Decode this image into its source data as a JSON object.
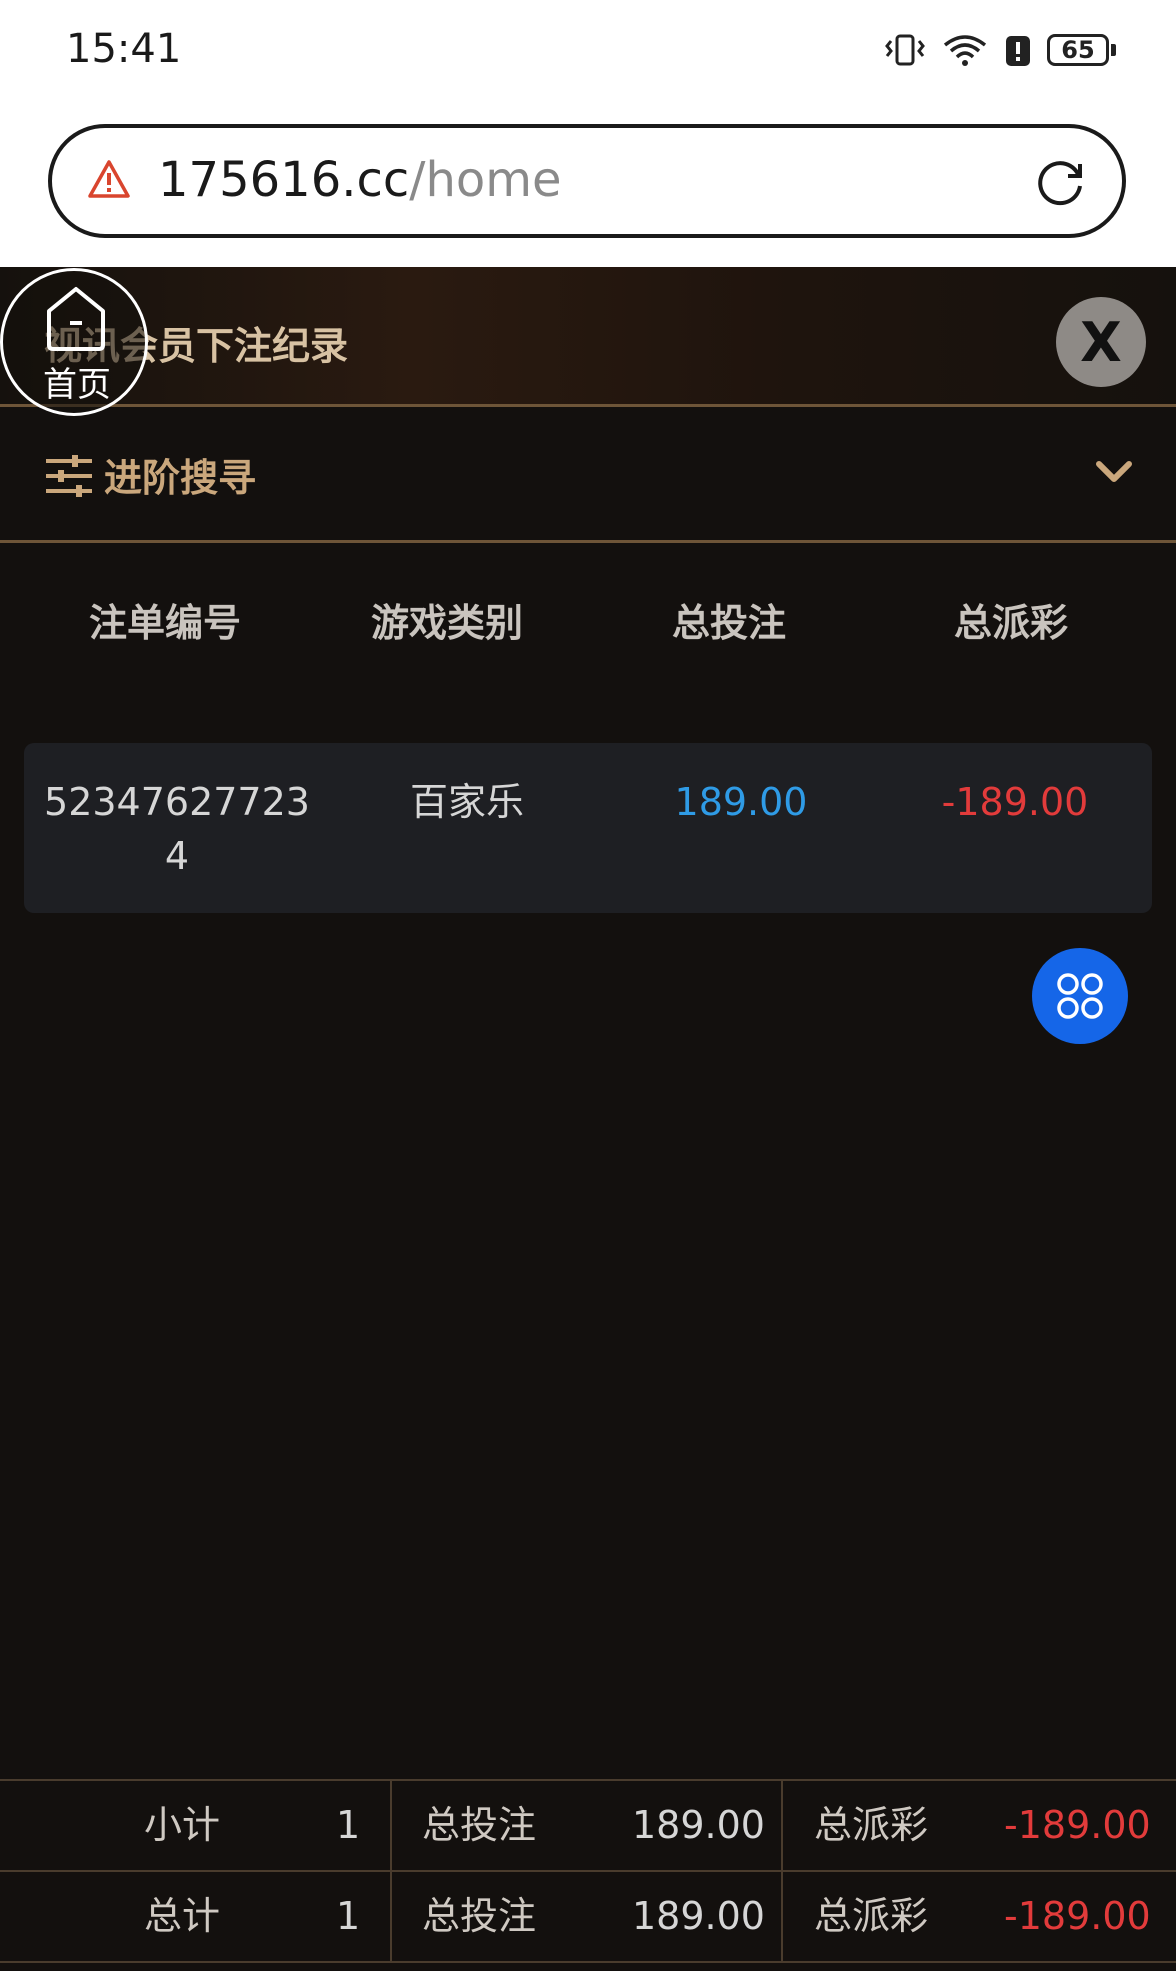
{
  "status_bar": {
    "time": "15:41",
    "battery": "65"
  },
  "browser": {
    "url_host": "175616.cc",
    "url_path": "/home"
  },
  "header": {
    "title": "视讯会员下注纪录",
    "close_label": "X"
  },
  "home_button": {
    "label": "首页"
  },
  "advanced_search": {
    "label": "进阶搜寻"
  },
  "table": {
    "headers": [
      "注单编号",
      "游戏类别",
      "总投注",
      "总派彩"
    ],
    "rows": [
      {
        "order_id": "523476277234",
        "game_category": "百家乐",
        "total_bet": "189.00",
        "total_payout": "-189.00"
      }
    ]
  },
  "summary": {
    "subtotal": {
      "label": "小计",
      "count": "1",
      "bet_label": "总投注",
      "bet": "189.00",
      "payout_label": "总派彩",
      "payout": "-189.00"
    },
    "total": {
      "label": "总计",
      "count": "1",
      "bet_label": "总投注",
      "bet": "189.00",
      "payout_label": "总派彩",
      "payout": "-189.00"
    }
  },
  "colors": {
    "bet": "#2f9be6",
    "payout_negative": "#e23b3b",
    "accent_gold": "#caa77c",
    "fab_blue": "#1566e8"
  }
}
